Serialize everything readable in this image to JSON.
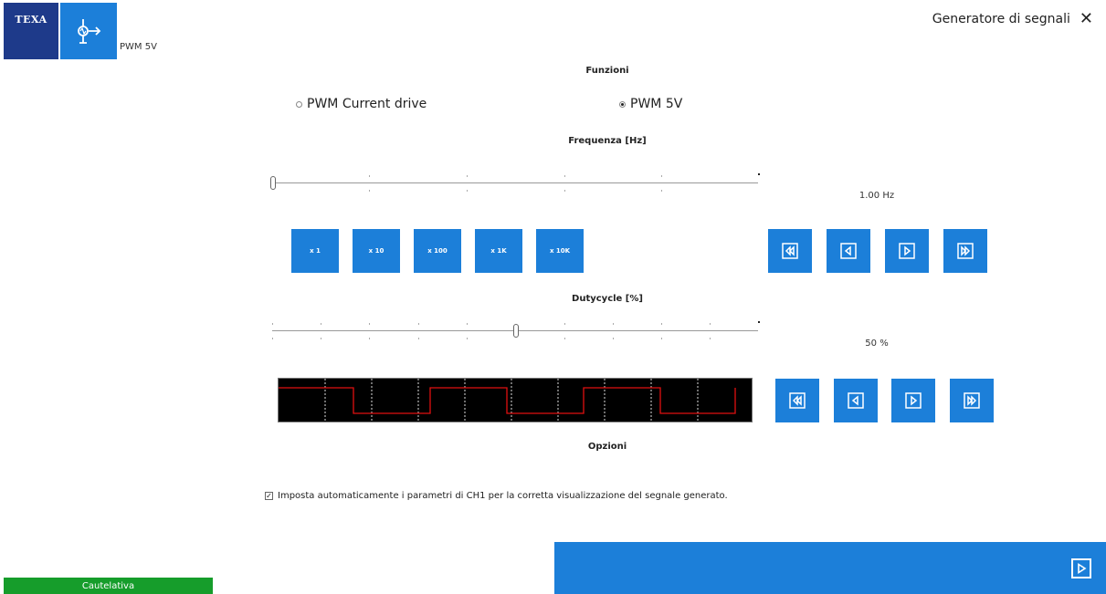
{
  "header": {
    "brand_logo_text": "TEXA",
    "module_subtitle": "PWM 5V",
    "window_title": "Generatore di segnali"
  },
  "functions": {
    "title": "Funzioni",
    "options": [
      {
        "label": "PWM Current drive",
        "selected": false
      },
      {
        "label": "PWM 5V",
        "selected": true
      }
    ]
  },
  "frequency": {
    "title": "Frequenza [Hz]",
    "value_text": "1.00 Hz",
    "slider_level": 0.0,
    "multipliers": [
      "x 1",
      "x 10",
      "x 100",
      "x 1K",
      "x 10K"
    ]
  },
  "dutycycle": {
    "title": "Dutycycle [%]",
    "value_text": "50 %",
    "slider_level": 0.5
  },
  "options_section": {
    "title": "Opzioni",
    "auto_params_checked": true,
    "auto_params_label": "Imposta automaticamente i parametri di CH1 per la corretta visualizzazione del segnale generato."
  },
  "status": {
    "label": "Cautelativa",
    "color": "#169d2b"
  },
  "colors": {
    "accent": "#1c7fd9",
    "brand_dark": "#1e3a8a",
    "scope_trace": "#e01010"
  }
}
